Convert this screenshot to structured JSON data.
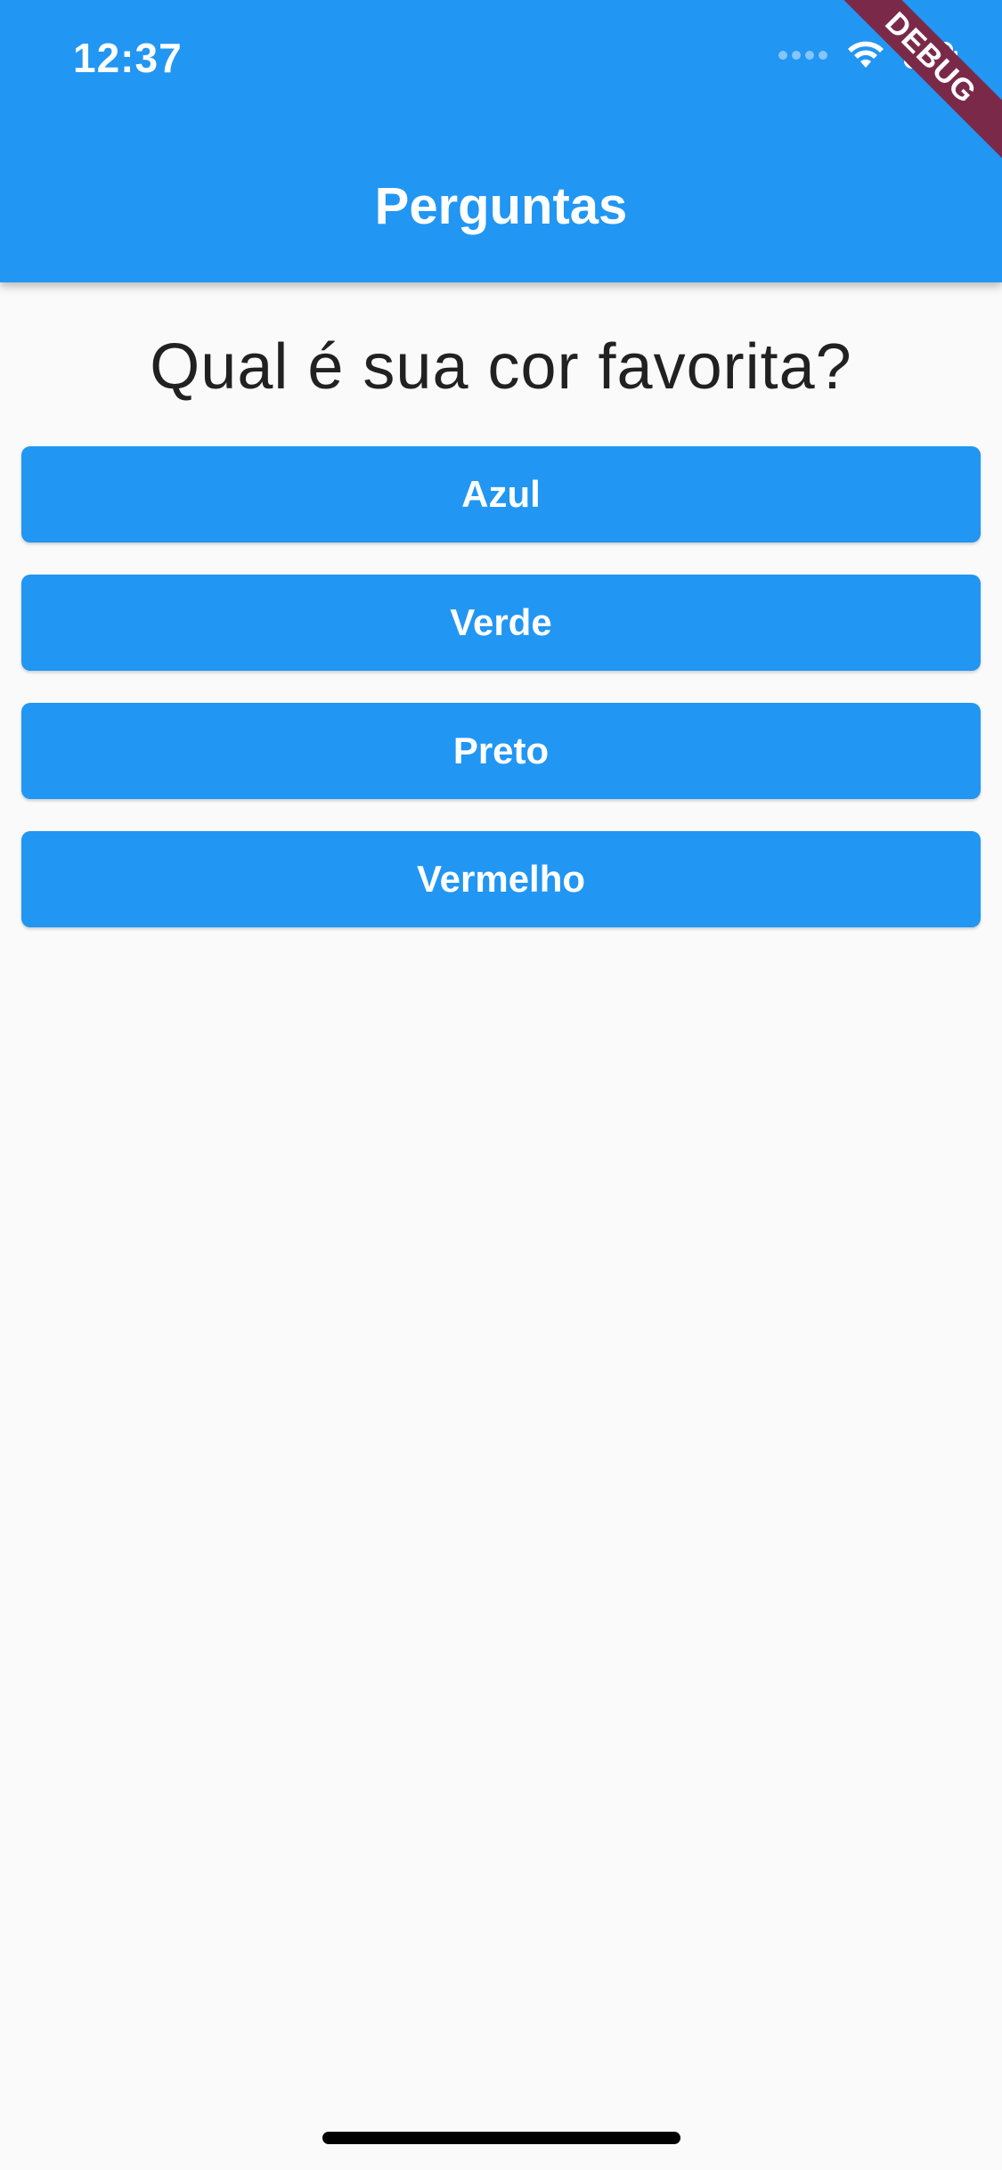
{
  "status_bar": {
    "time": "12:37",
    "icons": [
      "signal-dots-icon",
      "wifi-icon",
      "battery-icon"
    ]
  },
  "debug_banner": "DEBUG",
  "app_bar": {
    "title": "Perguntas"
  },
  "question": "Qual é sua cor favorita?",
  "answers": [
    {
      "label": "Azul"
    },
    {
      "label": "Verde"
    },
    {
      "label": "Preto"
    },
    {
      "label": "Vermelho"
    }
  ],
  "colors": {
    "primary": "#2196f3",
    "background": "#fafafa",
    "text": "#212121",
    "debug_banner": "#7a2a48"
  }
}
